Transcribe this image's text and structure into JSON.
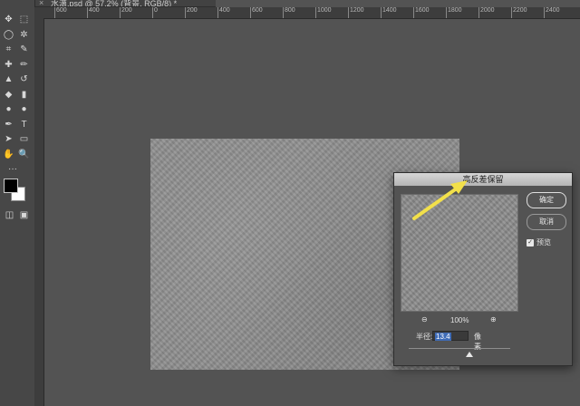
{
  "document_tab": {
    "title": "水滴.psd @ 57.2% (背景, RGB/8) *",
    "close_label": "×"
  },
  "rulers": {
    "top_ticks": [
      "600",
      "400",
      "200",
      "0",
      "200",
      "400",
      "600",
      "800",
      "1000",
      "1200",
      "1400",
      "1600",
      "1800",
      "2000",
      "2200",
      "2400"
    ]
  },
  "toolbar": {
    "tools": [
      {
        "name": "move-icon",
        "glyph": "✥"
      },
      {
        "name": "marquee-icon",
        "glyph": "⬚"
      },
      {
        "name": "lasso-icon",
        "glyph": "◯"
      },
      {
        "name": "magic-wand-icon",
        "glyph": "✲"
      },
      {
        "name": "crop-icon",
        "glyph": "⌗"
      },
      {
        "name": "eyedropper-icon",
        "glyph": "✎"
      },
      {
        "name": "healing-brush-icon",
        "glyph": "✚"
      },
      {
        "name": "brush-icon",
        "glyph": "✏"
      },
      {
        "name": "stamp-icon",
        "glyph": "▲"
      },
      {
        "name": "history-brush-icon",
        "glyph": "↺"
      },
      {
        "name": "eraser-icon",
        "glyph": "◆"
      },
      {
        "name": "gradient-icon",
        "glyph": "▮"
      },
      {
        "name": "blur-icon",
        "glyph": "●"
      },
      {
        "name": "dodge-icon",
        "glyph": "●"
      },
      {
        "name": "pen-icon",
        "glyph": "✒"
      },
      {
        "name": "type-icon",
        "glyph": "T"
      },
      {
        "name": "path-select-icon",
        "glyph": "➤"
      },
      {
        "name": "shape-icon",
        "glyph": "▭"
      },
      {
        "name": "hand-icon",
        "glyph": "✋"
      },
      {
        "name": "zoom-icon",
        "glyph": "🔍"
      },
      {
        "name": "more-tools-icon",
        "glyph": "···"
      }
    ],
    "foreground_color": "#000000",
    "background_color": "#ffffff"
  },
  "dialog": {
    "title": "高反差保留",
    "ok_label": "确定",
    "cancel_label": "取消",
    "preview_label": "预览",
    "preview_checked": true,
    "zoom_value": "100%",
    "radius_label": "半径:",
    "radius_value": "13.4",
    "unit_label": "像素",
    "radius_slider_fraction": 0.6
  },
  "annotation": {
    "arrow_color": "#f2e04a"
  }
}
